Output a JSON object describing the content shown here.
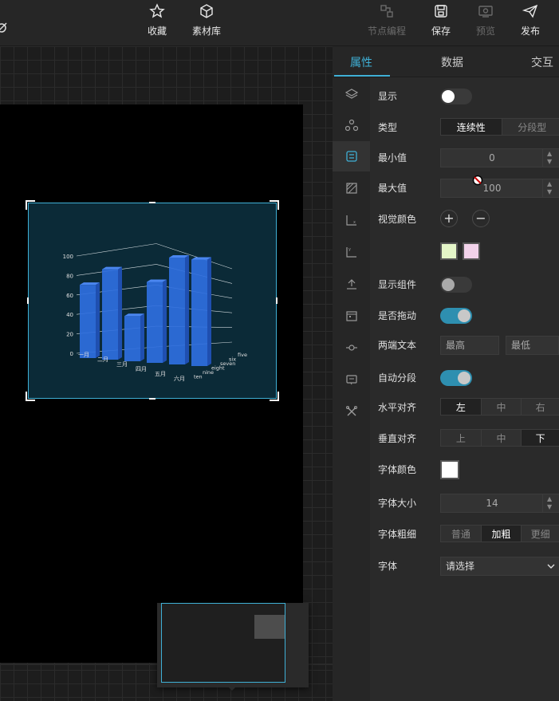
{
  "toolbar": {
    "favorites": "收藏",
    "materials": "素材库",
    "node_programming": "节点编程",
    "save": "保存",
    "preview": "预览",
    "publish": "发布"
  },
  "tabs": [
    {
      "label": "属性"
    },
    {
      "label": "数据"
    },
    {
      "label": "交互"
    }
  ],
  "props": {
    "show": {
      "label": "显示"
    },
    "type": {
      "label": "类型",
      "options": [
        "连续性",
        "分段型"
      ]
    },
    "min": {
      "label": "最小值",
      "value": "0"
    },
    "max": {
      "label": "最大值",
      "value": "100"
    },
    "visual_color": {
      "label": "视觉颜色",
      "add": "+",
      "remove": "−"
    },
    "show_component": {
      "label": "显示组件"
    },
    "draggable": {
      "label": "是否拖动"
    },
    "end_text": {
      "label": "两端文本",
      "high": "最高",
      "low": "最低"
    },
    "auto_segment": {
      "label": "自动分段"
    },
    "h_align": {
      "label": "水平对齐",
      "options": [
        "左",
        "中",
        "右"
      ]
    },
    "v_align": {
      "label": "垂直对齐",
      "options": [
        "上",
        "中",
        "下"
      ]
    },
    "font_color": {
      "label": "字体颜色"
    },
    "font_size": {
      "label": "字体大小",
      "value": "14"
    },
    "font_weight": {
      "label": "字体粗细",
      "options": [
        "普通",
        "加粗",
        "更细"
      ]
    },
    "font": {
      "label": "字体",
      "value": "请选择"
    }
  },
  "colors": {
    "accent": "#3fb0d6",
    "swatch1": "#e4f5c8",
    "swatch2": "#f2d2ea",
    "font_color": "#ffffff",
    "bar": "#2f6fe0"
  },
  "chart_data": {
    "type": "bar",
    "categories": [
      "一月",
      "二月",
      "三月",
      "四月",
      "五月",
      "六月"
    ],
    "series_names": [
      "five",
      "six",
      "seven",
      "eight",
      "nine",
      "ten"
    ],
    "yticks": [
      "0",
      "20",
      "40",
      "60",
      "80",
      "100"
    ],
    "ylim": [
      0,
      100
    ],
    "values": [
      72,
      88,
      40,
      75,
      100,
      98
    ]
  }
}
